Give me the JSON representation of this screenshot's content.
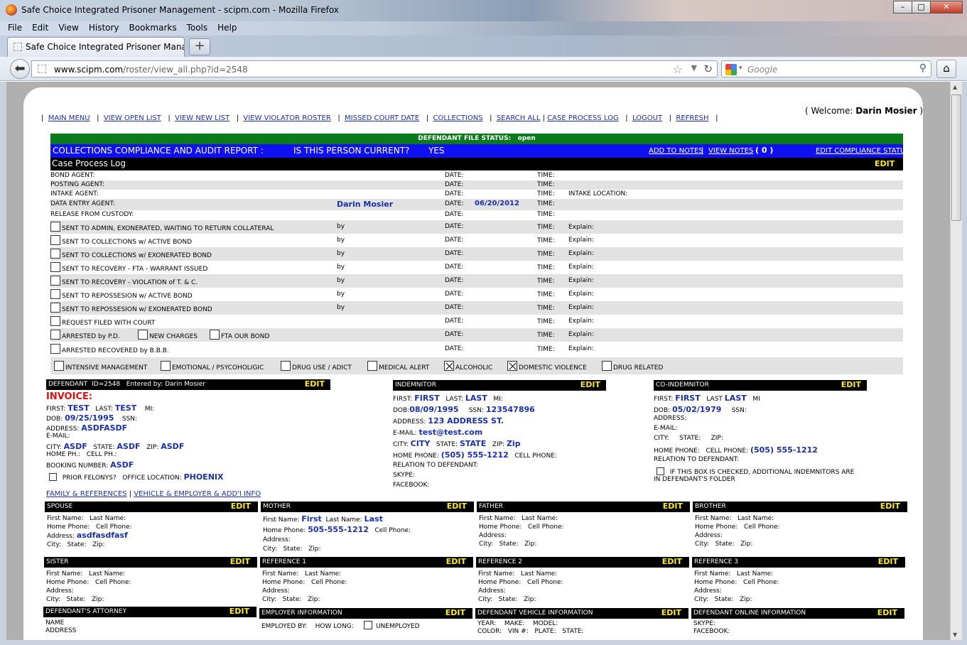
{
  "window": {
    "title": "Safe Choice Integrated Prisoner Management - scipm.com - Mozilla Firefox",
    "minimize": "–",
    "maximize": "□",
    "close": "✕"
  },
  "menu": [
    "File",
    "Edit",
    "View",
    "History",
    "Bookmarks",
    "Tools",
    "Help"
  ],
  "tab": {
    "label": "Safe Choice Integrated Prisoner Manage...",
    "new_tab": "+"
  },
  "nav": {
    "url_host": "www.scipm.com",
    "url_path": "/roster/view_all.php?id=2548",
    "search_placeholder": "Google"
  },
  "top_links": [
    "MAIN MENU",
    "VIEW OPEN LIST",
    "VIEW NEW LIST",
    "VIEW VIOLATOR ROSTER",
    "MISSED COURT DATE",
    "COLLECTIONS",
    "SEARCH ALL",
    "CASE PROCESS LOG",
    "LOGOUT",
    "REFRESH"
  ],
  "welcome": {
    "prefix": "( Welcome: ",
    "name": "Darin Mosier",
    "suffix": " )"
  },
  "status_bar": {
    "label": "DEFENDANT FILE STATUS:",
    "value": "open"
  },
  "compliance": {
    "title": "COLLECTIONS COMPLIANCE AND AUDIT REPORT :",
    "question": "IS THIS PERSON CURRENT?",
    "answer": "YES",
    "add_notes": "ADD TO NOTES",
    "view_notes": "VIEW NOTES",
    "notes_count": "( 0 )",
    "edit_status": "EDIT COMPLIANCE STATUS"
  },
  "case_log": {
    "title": "Case Process Log",
    "edit": "EDIT",
    "date_label": "DATE:",
    "time_label": "TIME:",
    "by_label": "by",
    "explain_label": "Explain:",
    "intake_location": "INTAKE LOCATION:",
    "agents": [
      {
        "label": "BOND AGENT:",
        "name": "",
        "date": ""
      },
      {
        "label": "POSTING AGENT:",
        "name": "",
        "date": ""
      },
      {
        "label": "INTAKE AGENT:",
        "name": "",
        "date": ""
      },
      {
        "label": "DATA ENTRY AGENT:",
        "name": "Darin Mosier",
        "date": "06/20/2012"
      },
      {
        "label": "RELEASE FROM CUSTODY:",
        "name": "",
        "date": ""
      }
    ],
    "actions": [
      "SENT TO ADMIN, EXONERATED, WAITING TO RETURN COLLATERAL",
      "SENT TO COLLECTIONS w/ ACTIVE BOND",
      "SENT TO COLLECTIONS w/ EXONERATED BOND",
      "SENT TO RECOVERY - FTA - WARRANT ISSUED",
      "SENT TO RECOVERY - VIOLATION of T. & C.",
      "SENT TO REPOSSESION w/ ACTIVE BOND",
      "SENT TO REPOSSESION w/ EXONERATED BOND"
    ],
    "request_court": "REQUEST FILED WITH COURT",
    "arrested_pd": "ARRESTED by P.D.",
    "new_charges": "NEW CHARGES",
    "fta_bond": "FTA OUR BOND",
    "arrested_bbb": "ARRESTED RECOVERED by B.B.B.",
    "flags": [
      {
        "label": "INTENSIVE MANAGEMENT",
        "checked": false
      },
      {
        "label": "EMOTIONAL / PSYCOHOLIGIC",
        "checked": false
      },
      {
        "label": "DRUG USE / ADICT",
        "checked": false
      },
      {
        "label": "MEDICAL ALERT",
        "checked": false
      },
      {
        "label": "ALCOHOLIC",
        "checked": true
      },
      {
        "label": "DOMESTIC VIOLENCE",
        "checked": true
      },
      {
        "label": "DRUG RELATED",
        "checked": false
      }
    ]
  },
  "defendant": {
    "header": "DEFENDANT",
    "id": "ID=2548",
    "entered_by": "Entered by: Darin Mosier",
    "edit": "EDIT",
    "invoice": "INVOICE:",
    "first_label": "FIRST:",
    "first": "TEST",
    "last_label": "LAST:",
    "last": "TEST",
    "mi_label": "MI:",
    "dob_label": "DOB:",
    "dob": "09/25/1995",
    "ssn_label": "SSN:",
    "address_label": "ADDRESS:",
    "address": "ASDFASDF",
    "email_label": "E-MAIL:",
    "city_label": "CITY:",
    "city": "ASDF",
    "state_label": "STATE:",
    "state": "ASDF",
    "zip_label": "ZIP:",
    "zip": "ASDF",
    "home_ph": "HOME PH.:",
    "cell_ph": "CELL PH.:",
    "booking_label": "BOOKING NUMBER:",
    "booking": "ASDF",
    "prior_felony": "PRIOR FELONYS?",
    "office_label": "OFFICE LOCATION:",
    "office": "PHOENIX",
    "family_link": "FAMILY & REFERENCES",
    "vehicle_link": "VEHICLE & EMPLOYER & ADD'I INFO"
  },
  "indemnitor": {
    "header": "INDEMNITOR",
    "edit": "EDIT",
    "first_label": "FIRST:",
    "first": "FIRST",
    "last_label": "LAST:",
    "last": "LAST",
    "mi_label": "MI:",
    "dob_label": "DOB:",
    "dob": "08/09/1995",
    "ssn_label": "SSN:",
    "ssn": "123547896",
    "address_label": "ADDRESS:",
    "address": "123 ADDRESS ST.",
    "email_label": "E-MAIL:",
    "email": "test@test.com",
    "city_label": "CITY:",
    "city": "CITY",
    "state_label": "STATE:",
    "state": "STATE",
    "zip_label": "ZIP:",
    "zip": "Zip",
    "home_label": "HOME PHONE:",
    "home": "(505) 555-1212",
    "cell_label": "CELL PHONE:",
    "relation": "RELATION TO DEFENDANT:",
    "skype": "SKYPE:",
    "facebook": "FACEBOOK:"
  },
  "co_indemnitor": {
    "header": "CO-INDEMNITOR",
    "edit": "EDIT",
    "first_label": "FIRST:",
    "first": "FIRST",
    "last_label": "LAST",
    "last": "LAST",
    "mi_label": "MI",
    "dob_label": "DOB:",
    "dob": "05/02/1979",
    "ssn_label": "SSN:",
    "address_label": "ADDRESS:",
    "email_label": "E-MAIL:",
    "city_label": "CITY:",
    "state_label": "STATE:",
    "zip_label": "ZIP:",
    "home_label": "HOME PHONE:",
    "cell_label": "CELL PHONE:",
    "cell": "(505) 555-1212",
    "relation": "RELATION TO DEFENDANT:",
    "note_line1": "IF THIS BOX IS CHECKED, ADDITIONAL INDEMNITORS ARE",
    "note_line2": "IN DEFENDANT'S FOLDER"
  },
  "contacts": {
    "first_label": "First Name:",
    "last_label": "Last Name:",
    "home_label": "Home Phone:",
    "cell_label": "Cell Phone:",
    "address_label": "Address:",
    "city_label": "City:",
    "state_label": "State:",
    "zip_label": "Zip:",
    "edit": "EDIT",
    "row1": [
      {
        "header": "SPOUSE",
        "first": "",
        "last": "",
        "home": "",
        "address": "asdfasdfasf"
      },
      {
        "header": "MOTHER",
        "first": "First",
        "last": "Last",
        "home": "505-555-1212",
        "address": ""
      },
      {
        "header": "FATHER",
        "first": "",
        "last": "",
        "home": "",
        "address": ""
      },
      {
        "header": "BROTHER",
        "first": "",
        "last": "",
        "home": "",
        "address": ""
      }
    ],
    "row2": [
      {
        "header": "SISTER"
      },
      {
        "header": "REFERENCE 1"
      },
      {
        "header": "REFERENCE 2"
      },
      {
        "header": "REFERENCE 3"
      }
    ]
  },
  "bottom": {
    "attorney": "DEFENDANT'S ATTORNEY",
    "attorney_name": "NAME",
    "attorney_address": "ADDRESS",
    "employer": "EMPLOYER INFORMATION",
    "employed_by": "EMPLOYED BY:",
    "how_long": "HOW LONG:",
    "unemployed": "UNEMPLOYED",
    "vehicle": "DEFENDANT VEHICLE INFORMATION",
    "year": "YEAR:",
    "make": "MAKE:",
    "model": "MODEL:",
    "color": "COLOR:",
    "vin": "VIN #:",
    "plate": "PLATE:",
    "vstate": "STATE:",
    "online": "DEFENDANT ONLINE INFORMATION",
    "skype": "SKYPE:",
    "facebook": "FACEBOOK:"
  }
}
